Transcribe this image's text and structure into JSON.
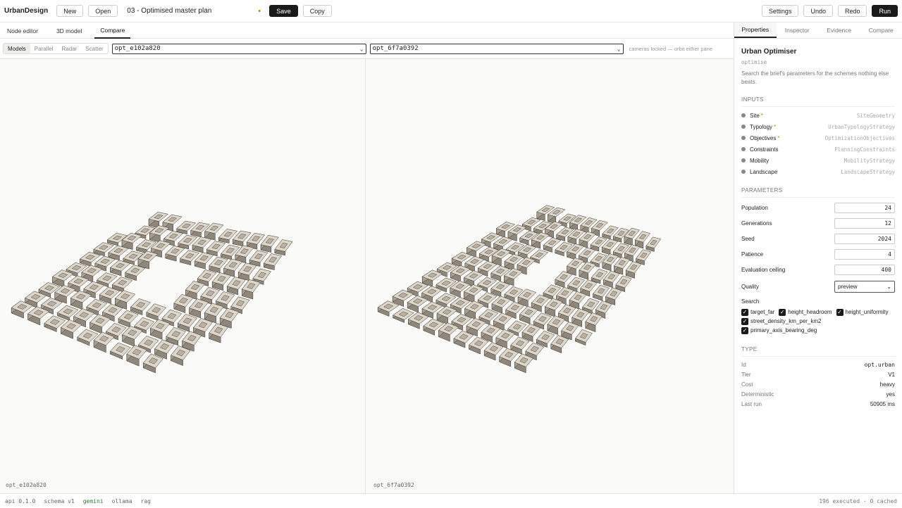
{
  "app": {
    "name": "UrbanDesign"
  },
  "toolbar": {
    "new_label": "New",
    "open_label": "Open",
    "doc_title": "03 - Optimised master plan",
    "dirty_indicator": "•",
    "save_label": "Save",
    "copy_label": "Copy",
    "settings_label": "Settings",
    "undo_label": "Undo",
    "redo_label": "Redo",
    "run_label": "Run"
  },
  "main_tabs": [
    "Node editor",
    "3D model",
    "Compare"
  ],
  "compare": {
    "modes": [
      "Models",
      "Parallel",
      "Radar",
      "Scatter"
    ],
    "left_select": "opt_e102a820",
    "right_select": "opt_6f7a0392",
    "hint": "cameras locked — orbit either pane",
    "left_label": "opt_e102a820",
    "right_label": "opt_6f7a0392"
  },
  "sidebar": {
    "tabs": [
      "Properties",
      "Inspector",
      "Evidence",
      "Compare"
    ],
    "node_title": "Urban Optimiser",
    "node_code": "optimise",
    "node_desc": "Search the brief's parameters for the schemes nothing else beats.",
    "inputs_heading": "INPUTS",
    "inputs": [
      {
        "name": "Site",
        "req": "*",
        "type": "SiteGeometry"
      },
      {
        "name": "Typology",
        "req": "*",
        "type": "UrbanTypologyStrategy"
      },
      {
        "name": "Objectives",
        "req": "*",
        "type": "OptimizationObjectives"
      },
      {
        "name": "Constraints",
        "req": "",
        "type": "PlanningConstraints"
      },
      {
        "name": "Mobility",
        "req": "",
        "type": "MobilityStrategy"
      },
      {
        "name": "Landscape",
        "req": "",
        "type": "LandscapeStrategy"
      }
    ],
    "parameters_heading": "PARAMETERS",
    "parameters": [
      {
        "name": "Population",
        "value": "24"
      },
      {
        "name": "Generations",
        "value": "12"
      },
      {
        "name": "Seed",
        "value": "2024"
      },
      {
        "name": "Patience",
        "value": "4"
      },
      {
        "name": "Evaluation ceiling",
        "value": "400"
      }
    ],
    "quality": {
      "name": "Quality",
      "value": "preview"
    },
    "search_label": "Search",
    "search_checks": [
      "target_far",
      "height_headroom",
      "height_uniformity",
      "street_density_km_per_km2",
      "primary_axis_bearing_deg"
    ],
    "type_heading": "TYPE",
    "type_rows": [
      {
        "k": "Id",
        "v": "opt.urban"
      },
      {
        "k": "Tier",
        "v": "V1"
      },
      {
        "k": "Cost",
        "v": "heavy"
      },
      {
        "k": "Deterministic",
        "v": "yes"
      },
      {
        "k": "Last run",
        "v": "50905 ms"
      }
    ]
  },
  "status": {
    "api": "api 0.1.0",
    "schema": "schema v1",
    "gemini": "gemini",
    "ollama": "ollama",
    "rag": "rag",
    "executed": "196 executed · 0 cached"
  },
  "colors": {
    "accent_orange": "#d07800",
    "ok_green": "#2e7d32",
    "building_top": "#d9d2c6",
    "building_side": "#8a8276"
  }
}
